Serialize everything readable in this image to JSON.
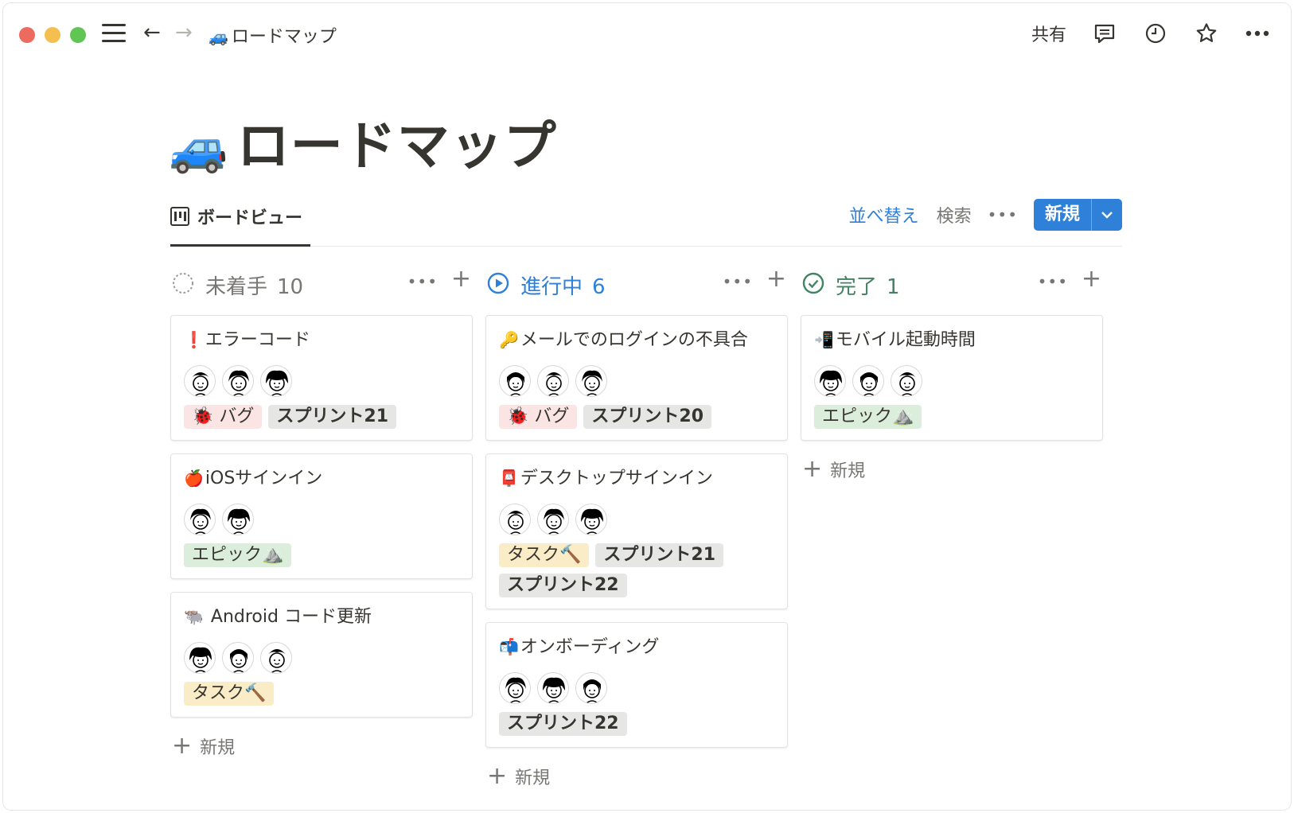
{
  "window": {
    "breadcrumb": "ロードマップ",
    "breadcrumb_icon": "blue-car-icon"
  },
  "topbar": {
    "share": "共有",
    "icons": [
      "comment-icon",
      "clock-icon",
      "star-icon",
      "more-icon"
    ]
  },
  "page": {
    "title": "ロードマップ",
    "title_icon": "blue-car-icon"
  },
  "view": {
    "tab_label": "ボードビュー",
    "sort": "並べ替え",
    "search": "検索",
    "more": "•••",
    "new": "新規"
  },
  "colors": {
    "accent": "#2f80d8",
    "not_started": "#787774",
    "in_progress": "#2f80d8",
    "done": "#448361"
  },
  "columns": [
    {
      "title": "未着手",
      "count": "10",
      "status_icon": "dotted-circle-icon",
      "new_label": "新規",
      "cards": [
        {
          "emoji": "❗",
          "title": "エラーコード",
          "avatars": 3,
          "tags": [
            {
              "label": "🐞 バグ",
              "kind": "bug"
            },
            {
              "label": "スプリント21",
              "kind": "sprint"
            }
          ]
        },
        {
          "emoji": "🍎",
          "title": "iOSサインイン",
          "avatars": 2,
          "tags": [
            {
              "label": "エピック⛰️",
              "kind": "epic"
            }
          ]
        },
        {
          "emoji": "🐃",
          "title": " Android コード更新",
          "avatars": 3,
          "tags": [
            {
              "label": "タスク🔨",
              "kind": "task"
            }
          ]
        }
      ]
    },
    {
      "title": "進行中",
      "count": "6",
      "status_icon": "play-circle-icon",
      "new_label": "新規",
      "cards": [
        {
          "emoji": "🔑",
          "title": "メールでのログインの不具合",
          "avatars": 3,
          "tags": [
            {
              "label": "🐞 バグ",
              "kind": "bug"
            },
            {
              "label": "スプリント20",
              "kind": "sprint"
            }
          ]
        },
        {
          "emoji": "📮",
          "title": "デスクトップサインイン",
          "avatars": 3,
          "tags": [
            {
              "label": "タスク🔨",
              "kind": "task"
            },
            {
              "label": "スプリント21",
              "kind": "sprint"
            },
            {
              "label": "スプリント22",
              "kind": "sprint"
            }
          ]
        },
        {
          "emoji": "📬",
          "title": "オンボーディング",
          "avatars": 3,
          "tags": [
            {
              "label": "スプリント22",
              "kind": "sprint"
            }
          ]
        }
      ]
    },
    {
      "title": "完了",
      "count": "1",
      "status_icon": "check-circle-icon",
      "new_label": "新規",
      "cards": [
        {
          "emoji": "📲",
          "title": "モバイル起動時間",
          "avatars": 3,
          "tags": [
            {
              "label": "エピック⛰️",
              "kind": "epic"
            }
          ]
        }
      ]
    }
  ]
}
